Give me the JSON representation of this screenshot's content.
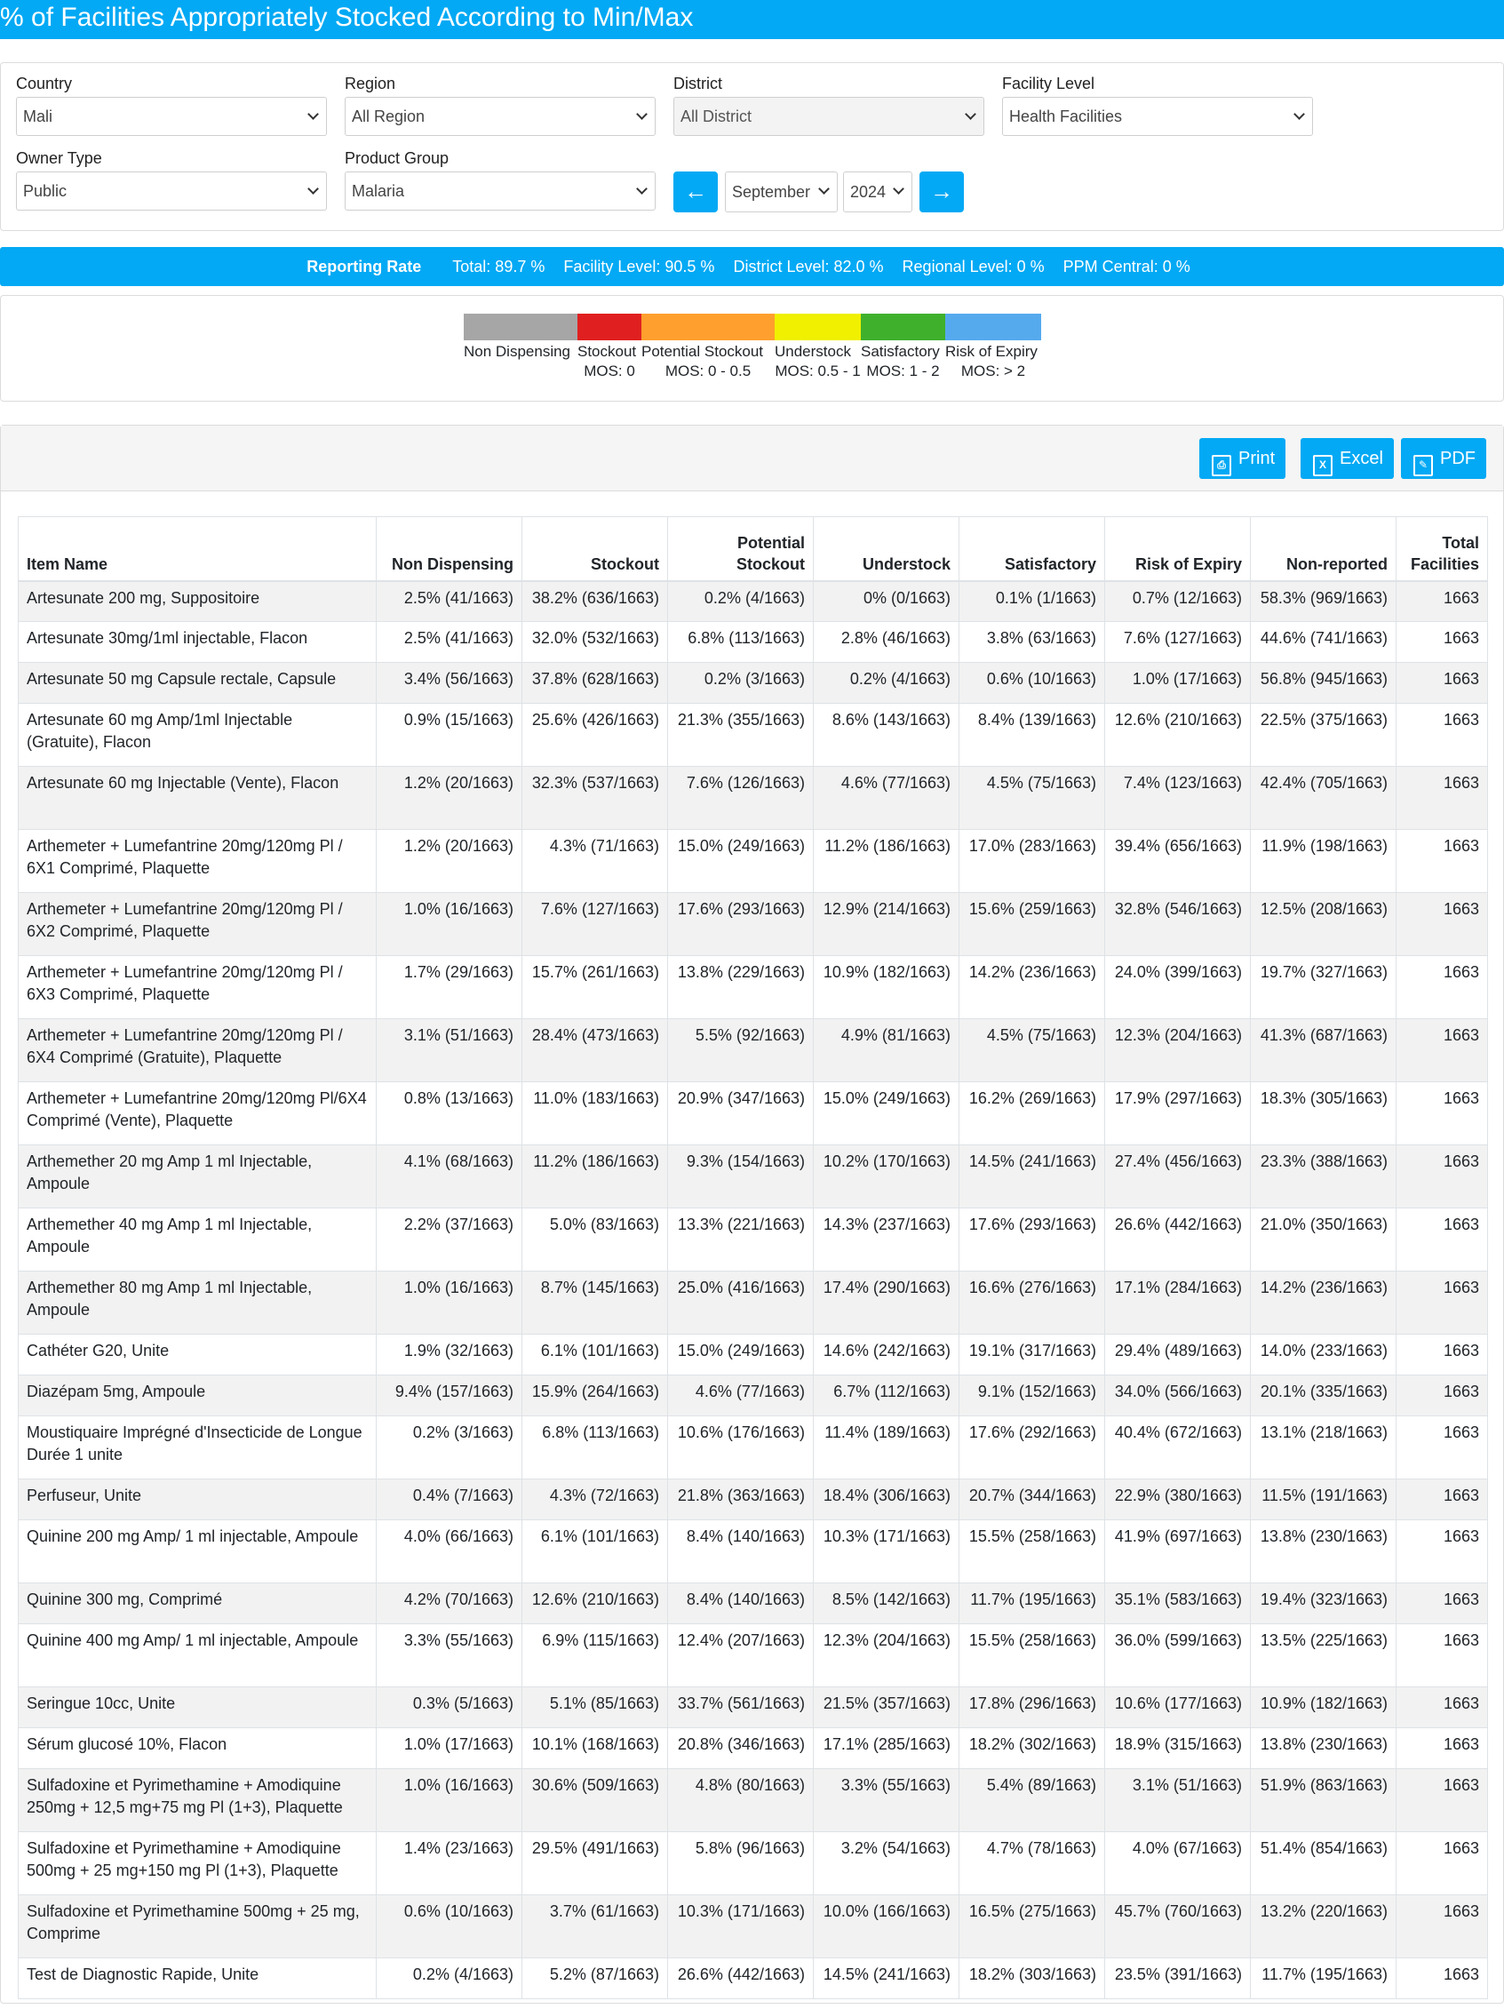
{
  "page": {
    "title": "% of Facilities Appropriately Stocked According to Min/Max"
  },
  "filters": {
    "country": {
      "label": "Country",
      "value": "Mali"
    },
    "region": {
      "label": "Region",
      "value": "All Region"
    },
    "district": {
      "label": "District",
      "value": "All District"
    },
    "facility_level": {
      "label": "Facility Level",
      "value": "Health Facilities"
    },
    "owner_type": {
      "label": "Owner Type",
      "value": "Public"
    },
    "product_group": {
      "label": "Product Group",
      "value": "Malaria"
    },
    "month": "September",
    "year": "2024",
    "prev_icon": "arrow-left-icon",
    "next_icon": "arrow-right-icon"
  },
  "reporting": {
    "label": "Reporting Rate",
    "total": "Total: 89.7 %",
    "facility": "Facility Level: 90.5 %",
    "district": "District Level: 82.0 %",
    "regional": "Regional Level: 0 %",
    "ppm": "PPM Central: 0 %"
  },
  "legend": [
    {
      "label": "Non Dispensing",
      "mos": "",
      "color": "#a6a6a6"
    },
    {
      "label": "Stockout",
      "mos": "MOS: 0",
      "color": "#e02020"
    },
    {
      "label": "Potential Stockout",
      "mos": "MOS: 0 - 0.5",
      "color": "#ff9f2e"
    },
    {
      "label": "Understock",
      "mos": "MOS: 0.5 - 1",
      "color": "#f0f000"
    },
    {
      "label": "Satisfactory",
      "mos": "MOS: 1 - 2",
      "color": "#3fb02c"
    },
    {
      "label": "Risk of Expiry",
      "mos": "MOS: > 2",
      "color": "#55aaee"
    }
  ],
  "toolbar": {
    "print": "Print",
    "excel": "Excel",
    "pdf": "PDF"
  },
  "table": {
    "headers": [
      "Item Name",
      "Non Dispensing",
      "Stockout",
      "Potential Stockout",
      "Understock",
      "Satisfactory",
      "Risk of Expiry",
      "Non-reported",
      "Total Facilities"
    ],
    "rows": [
      [
        "Artesunate 200 mg, Suppositoire",
        "2.5% (41/1663)",
        "38.2% (636/1663)",
        "0.2% (4/1663)",
        "0% (0/1663)",
        "0.1% (1/1663)",
        "0.7% (12/1663)",
        "58.3% (969/1663)",
        "1663"
      ],
      [
        "Artesunate 30mg/1ml injectable, Flacon",
        "2.5% (41/1663)",
        "32.0% (532/1663)",
        "6.8% (113/1663)",
        "2.8% (46/1663)",
        "3.8% (63/1663)",
        "7.6% (127/1663)",
        "44.6% (741/1663)",
        "1663"
      ],
      [
        "Artesunate 50 mg Capsule rectale, Capsule",
        "3.4% (56/1663)",
        "37.8% (628/1663)",
        "0.2% (3/1663)",
        "0.2% (4/1663)",
        "0.6% (10/1663)",
        "1.0% (17/1663)",
        "56.8% (945/1663)",
        "1663"
      ],
      [
        "Artesunate 60 mg Amp/1ml Injectable (Gratuite), Flacon",
        "0.9% (15/1663)",
        "25.6% (426/1663)",
        "21.3% (355/1663)",
        "8.6% (143/1663)",
        "8.4% (139/1663)",
        "12.6% (210/1663)",
        "22.5% (375/1663)",
        "1663"
      ],
      [
        "Artesunate 60 mg Injectable (Vente), Flacon",
        "1.2% (20/1663)",
        "32.3% (537/1663)",
        "7.6% (126/1663)",
        "4.6% (77/1663)",
        "4.5% (75/1663)",
        "7.4% (123/1663)",
        "42.4% (705/1663)",
        "1663"
      ],
      [
        "Arthemeter + Lumefantrine 20mg/120mg Pl / 6X1 Comprimé, Plaquette",
        "1.2% (20/1663)",
        "4.3% (71/1663)",
        "15.0% (249/1663)",
        "11.2% (186/1663)",
        "17.0% (283/1663)",
        "39.4% (656/1663)",
        "11.9% (198/1663)",
        "1663"
      ],
      [
        "Arthemeter + Lumefantrine 20mg/120mg Pl / 6X2 Comprimé, Plaquette",
        "1.0% (16/1663)",
        "7.6% (127/1663)",
        "17.6% (293/1663)",
        "12.9% (214/1663)",
        "15.6% (259/1663)",
        "32.8% (546/1663)",
        "12.5% (208/1663)",
        "1663"
      ],
      [
        "Arthemeter + Lumefantrine 20mg/120mg Pl / 6X3 Comprimé, Plaquette",
        "1.7% (29/1663)",
        "15.7% (261/1663)",
        "13.8% (229/1663)",
        "10.9% (182/1663)",
        "14.2% (236/1663)",
        "24.0% (399/1663)",
        "19.7% (327/1663)",
        "1663"
      ],
      [
        "Arthemeter + Lumefantrine 20mg/120mg Pl / 6X4 Comprimé (Gratuite), Plaquette",
        "3.1% (51/1663)",
        "28.4% (473/1663)",
        "5.5% (92/1663)",
        "4.9% (81/1663)",
        "4.5% (75/1663)",
        "12.3% (204/1663)",
        "41.3% (687/1663)",
        "1663"
      ],
      [
        "Arthemeter + Lumefantrine 20mg/120mg Pl/6X4 Comprimé (Vente), Plaquette",
        "0.8% (13/1663)",
        "11.0% (183/1663)",
        "20.9% (347/1663)",
        "15.0% (249/1663)",
        "16.2% (269/1663)",
        "17.9% (297/1663)",
        "18.3% (305/1663)",
        "1663"
      ],
      [
        "Arthemether 20 mg Amp 1 ml Injectable, Ampoule",
        "4.1% (68/1663)",
        "11.2% (186/1663)",
        "9.3% (154/1663)",
        "10.2% (170/1663)",
        "14.5% (241/1663)",
        "27.4% (456/1663)",
        "23.3% (388/1663)",
        "1663"
      ],
      [
        "Arthemether 40 mg Amp 1 ml Injectable, Ampoule",
        "2.2% (37/1663)",
        "5.0% (83/1663)",
        "13.3% (221/1663)",
        "14.3% (237/1663)",
        "17.6% (293/1663)",
        "26.6% (442/1663)",
        "21.0% (350/1663)",
        "1663"
      ],
      [
        "Arthemether 80 mg Amp 1 ml Injectable, Ampoule",
        "1.0% (16/1663)",
        "8.7% (145/1663)",
        "25.0% (416/1663)",
        "17.4% (290/1663)",
        "16.6% (276/1663)",
        "17.1% (284/1663)",
        "14.2% (236/1663)",
        "1663"
      ],
      [
        "Cathéter G20, Unite",
        "1.9% (32/1663)",
        "6.1% (101/1663)",
        "15.0% (249/1663)",
        "14.6% (242/1663)",
        "19.1% (317/1663)",
        "29.4% (489/1663)",
        "14.0% (233/1663)",
        "1663"
      ],
      [
        "Diazépam 5mg, Ampoule",
        "9.4% (157/1663)",
        "15.9% (264/1663)",
        "4.6% (77/1663)",
        "6.7% (112/1663)",
        "9.1% (152/1663)",
        "34.0% (566/1663)",
        "20.1% (335/1663)",
        "1663"
      ],
      [
        "Moustiquaire Imprégné d'Insecticide de Longue Durée 1 unite",
        "0.2% (3/1663)",
        "6.8% (113/1663)",
        "10.6% (176/1663)",
        "11.4% (189/1663)",
        "17.6% (292/1663)",
        "40.4% (672/1663)",
        "13.1% (218/1663)",
        "1663"
      ],
      [
        "Perfuseur, Unite",
        "0.4% (7/1663)",
        "4.3% (72/1663)",
        "21.8% (363/1663)",
        "18.4% (306/1663)",
        "20.7% (344/1663)",
        "22.9% (380/1663)",
        "11.5% (191/1663)",
        "1663"
      ],
      [
        "Quinine 200 mg Amp/ 1 ml injectable, Ampoule",
        "4.0% (66/1663)",
        "6.1% (101/1663)",
        "8.4% (140/1663)",
        "10.3% (171/1663)",
        "15.5% (258/1663)",
        "41.9% (697/1663)",
        "13.8% (230/1663)",
        "1663"
      ],
      [
        "Quinine 300 mg, Comprimé",
        "4.2% (70/1663)",
        "12.6% (210/1663)",
        "8.4% (140/1663)",
        "8.5% (142/1663)",
        "11.7% (195/1663)",
        "35.1% (583/1663)",
        "19.4% (323/1663)",
        "1663"
      ],
      [
        "Quinine 400 mg Amp/ 1 ml injectable, Ampoule",
        "3.3% (55/1663)",
        "6.9% (115/1663)",
        "12.4% (207/1663)",
        "12.3% (204/1663)",
        "15.5% (258/1663)",
        "36.0% (599/1663)",
        "13.5% (225/1663)",
        "1663"
      ],
      [
        "Seringue 10cc, Unite",
        "0.3% (5/1663)",
        "5.1% (85/1663)",
        "33.7% (561/1663)",
        "21.5% (357/1663)",
        "17.8% (296/1663)",
        "10.6% (177/1663)",
        "10.9% (182/1663)",
        "1663"
      ],
      [
        "Sérum glucosé 10%, Flacon",
        "1.0% (17/1663)",
        "10.1% (168/1663)",
        "20.8% (346/1663)",
        "17.1% (285/1663)",
        "18.2% (302/1663)",
        "18.9% (315/1663)",
        "13.8% (230/1663)",
        "1663"
      ],
      [
        "Sulfadoxine et Pyrimethamine + Amodiquine 250mg + 12,5 mg+75 mg Pl (1+3), Plaquette",
        "1.0% (16/1663)",
        "30.6% (509/1663)",
        "4.8% (80/1663)",
        "3.3% (55/1663)",
        "5.4% (89/1663)",
        "3.1% (51/1663)",
        "51.9% (863/1663)",
        "1663"
      ],
      [
        "Sulfadoxine et Pyrimethamine + Amodiquine 500mg + 25 mg+150 mg Pl (1+3), Plaquette",
        "1.4% (23/1663)",
        "29.5% (491/1663)",
        "5.8% (96/1663)",
        "3.2% (54/1663)",
        "4.7% (78/1663)",
        "4.0% (67/1663)",
        "51.4% (854/1663)",
        "1663"
      ],
      [
        "Sulfadoxine et Pyrimethamine 500mg + 25 mg, Comprime",
        "0.6% (10/1663)",
        "3.7% (61/1663)",
        "10.3% (171/1663)",
        "10.0% (166/1663)",
        "16.5% (275/1663)",
        "45.7% (760/1663)",
        "13.2% (220/1663)",
        "1663"
      ],
      [
        "Test de Diagnostic Rapide, Unite",
        "0.2% (4/1663)",
        "5.2% (87/1663)",
        "26.6% (442/1663)",
        "14.5% (241/1663)",
        "18.2% (303/1663)",
        "23.5% (391/1663)",
        "11.7% (195/1663)",
        "1663"
      ]
    ]
  }
}
